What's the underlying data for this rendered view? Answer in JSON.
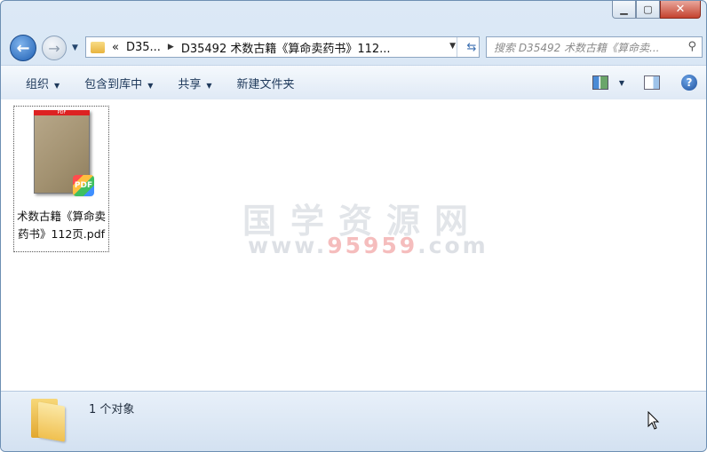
{
  "titlebar": {
    "minimize_icon": "minimize-icon",
    "maximize_icon": "maximize-icon",
    "close_icon": "close-icon"
  },
  "nav": {
    "back_icon": "back-arrow-icon",
    "forward_icon": "forward-arrow-icon"
  },
  "address": {
    "overflow": "«",
    "crumbs": [
      "D35...",
      "D35492 术数古籍《算命卖药书》112..."
    ],
    "refresh_icon": "refresh-icon"
  },
  "search": {
    "placeholder": "搜索 D35492 术数古籍《算命卖..."
  },
  "toolbar": {
    "organize": "组织",
    "include_library": "包含到库中",
    "share": "共享",
    "new_folder": "新建文件夹"
  },
  "files": [
    {
      "name": "术数古籍《算命卖药书》112页.pdf",
      "badge": "PDF",
      "thumb_label": "PDF"
    }
  ],
  "watermark": {
    "line1": "国学资源网",
    "line2_a": "www.",
    "line2_b": "95959",
    "line2_c": ".com"
  },
  "status": {
    "count": "1 个对象"
  },
  "colors": {
    "accent": "#1e5fb3",
    "close": "#c4432f"
  }
}
